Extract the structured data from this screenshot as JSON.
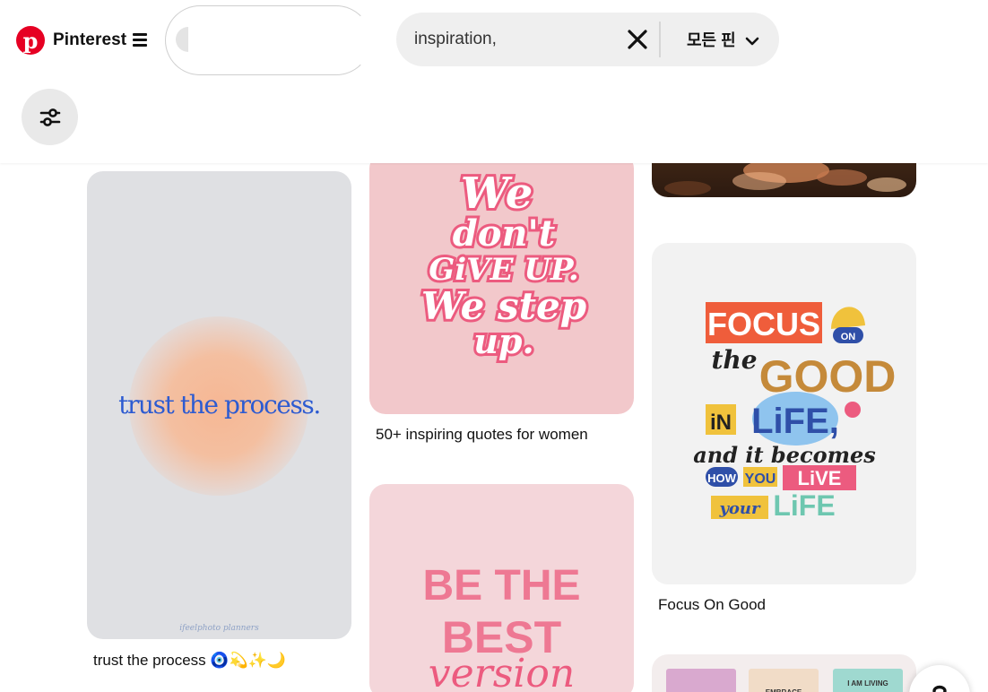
{
  "header": {
    "brand": "Pinterest",
    "logo_letter": "p",
    "search": {
      "value": "inspiration,",
      "scope_label": "모든 핀"
    }
  },
  "pins": {
    "trust": {
      "image_text": "trust the process.",
      "signature": "ifeelphoto planners",
      "caption": "trust the process 🧿💫✨🌙"
    },
    "quotes": {
      "image_lines": [
        "We",
        "don't",
        "GiVE UP.",
        "We step",
        "up."
      ],
      "caption": "50+ inspiring quotes for women"
    },
    "focus": {
      "image_lines": [
        "FOCUS",
        "ON",
        "the",
        "GOOD",
        "iN",
        "LiFE,",
        "and it becomes",
        "HOW",
        "YOU",
        "LiVE",
        "your",
        "LiFE"
      ],
      "caption": "Focus On Good"
    },
    "best": {
      "image_lines": [
        "BE THE",
        "BEST",
        "version"
      ]
    },
    "cards": {
      "card_labels": [
        "EMBRACE",
        "I AM LIVING"
      ]
    }
  },
  "colors": {
    "brand_red": "#e60023",
    "search_bg": "#efefef",
    "trust_blue": "#2d5bd1",
    "quote_pink": "#ec5b7f",
    "best_pink": "#ee7893"
  },
  "icons": {
    "menu": "menu-icon",
    "clear": "close-icon",
    "scope": "chevron-down-icon",
    "filter": "filter-icon",
    "help": "help-icon"
  }
}
